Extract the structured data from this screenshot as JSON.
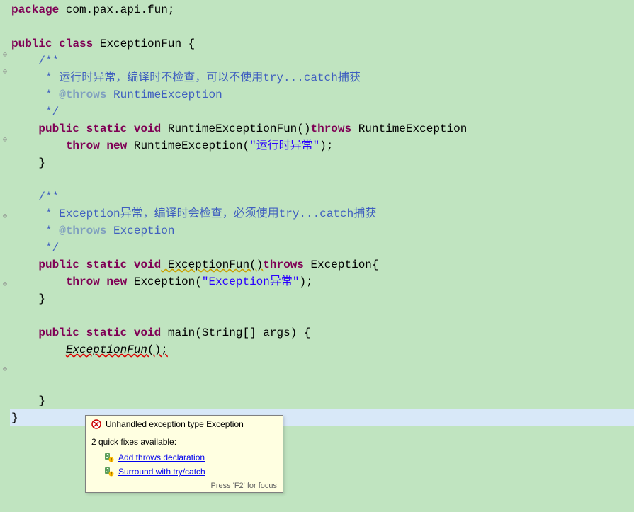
{
  "code": {
    "pkg_kw": "package",
    "pkg_name": " com.pax.api.fun;",
    "class_decl_public": "public",
    "class_decl_class": "class",
    "class_name": " ExceptionFun {",
    "doc1_open": "    /**",
    "doc1_l1": "     * 运行时异常，编译时不检查，可以不使用try...catch捕获",
    "doc1_l2a": "     * ",
    "doc1_l2_tag": "@throws",
    "doc1_l2b": " RuntimeException",
    "doc1_close": "     */",
    "m1_public": "    public",
    "m1_static": " static",
    "m1_void": " void",
    "m1_name": " RuntimeExceptionFun()",
    "m1_throws": "throws",
    "m1_exc": " RuntimeException",
    "m1_body_throw": "        throw",
    "m1_body_new": " new",
    "m1_body_type": " RuntimeException(",
    "m1_body_str": "\"运行时异常\"",
    "m1_body_end": ");",
    "m1_close": "    }",
    "doc2_open": "    /**",
    "doc2_l1": "     * Exception异常，编译时会检查，必须使用try...catch捕获",
    "doc2_l2a": "     * ",
    "doc2_l2_tag": "@throws",
    "doc2_l2b": " Exception",
    "doc2_close": "     */",
    "m2_public": "    public",
    "m2_static": " static",
    "m2_void": " void",
    "m2_name": " ExceptionFun()",
    "m2_throws": "throws",
    "m2_exc": " Exception{",
    "m2_body_throw": "        throw",
    "m2_body_new": " new",
    "m2_body_type": " Exception(",
    "m2_body_str": "\"Exception异常\"",
    "m2_body_end": ");",
    "m2_close": "    }",
    "m3_public": "    public",
    "m3_static": " static",
    "m3_void": " void",
    "m3_sig": " main(String[] args) {",
    "m3_call": "        ",
    "m3_call_name": "ExceptionFun",
    "m3_call_end": "();",
    "m3_close": "    }",
    "class_close": "}"
  },
  "tooltip": {
    "error_msg": "Unhandled exception type Exception",
    "fixes_header": "2 quick fixes available:",
    "fix1": "Add throws declaration",
    "fix2": "Surround with try/catch",
    "footer": "Press 'F2' for focus"
  }
}
